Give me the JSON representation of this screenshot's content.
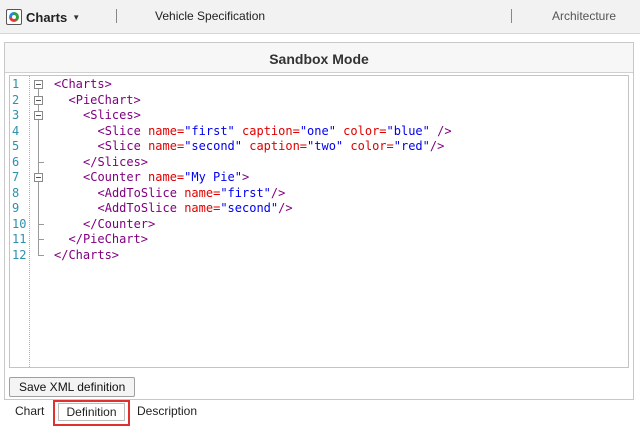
{
  "app": {
    "name": "Charts",
    "logo_icon": "pie-chart-logo-icon"
  },
  "top_tabs": [
    {
      "label": "Vehicle Specification"
    },
    {
      "label": "Architecture"
    }
  ],
  "panel": {
    "title": "Sandbox Mode"
  },
  "editor": {
    "lines": [
      {
        "n": "1",
        "parts": [
          [
            "tag",
            "<Charts>"
          ]
        ]
      },
      {
        "n": "2",
        "parts": [
          [
            "tag",
            "<PieChart>"
          ]
        ]
      },
      {
        "n": "3",
        "parts": [
          [
            "tag",
            "<Slices>"
          ]
        ]
      },
      {
        "n": "4",
        "parts": [
          [
            "tag",
            "<Slice "
          ],
          [
            "attr",
            "name="
          ],
          [
            "val",
            "\"first\""
          ],
          [
            "plain",
            " "
          ],
          [
            "attr",
            "caption="
          ],
          [
            "val",
            "\"one\""
          ],
          [
            "plain",
            " "
          ],
          [
            "attr",
            "color="
          ],
          [
            "val",
            "\"blue\""
          ],
          [
            "plain",
            " "
          ],
          [
            "tag",
            "/>"
          ]
        ]
      },
      {
        "n": "5",
        "parts": [
          [
            "tag",
            "<Slice "
          ],
          [
            "attr",
            "name="
          ],
          [
            "val",
            "\"second\""
          ],
          [
            "plain",
            " "
          ],
          [
            "attr",
            "caption="
          ],
          [
            "val",
            "\"two\""
          ],
          [
            "plain",
            " "
          ],
          [
            "attr",
            "color="
          ],
          [
            "val",
            "\"red\""
          ],
          [
            "tag",
            "/>"
          ]
        ]
      },
      {
        "n": "6",
        "parts": [
          [
            "tag",
            "</Slices>"
          ]
        ]
      },
      {
        "n": "7",
        "parts": [
          [
            "tag",
            "<Counter "
          ],
          [
            "attr",
            "name="
          ],
          [
            "val",
            "\"My Pie\""
          ],
          [
            "tag",
            ">"
          ]
        ]
      },
      {
        "n": "8",
        "parts": [
          [
            "tag",
            "<AddToSlice "
          ],
          [
            "attr",
            "name="
          ],
          [
            "val",
            "\"first\""
          ],
          [
            "tag",
            "/>"
          ]
        ]
      },
      {
        "n": "9",
        "parts": [
          [
            "tag",
            "<AddToSlice "
          ],
          [
            "attr",
            "name="
          ],
          [
            "val",
            "\"second\""
          ],
          [
            "tag",
            "/>"
          ]
        ]
      },
      {
        "n": "10",
        "parts": [
          [
            "tag",
            "</Counter>"
          ]
        ]
      },
      {
        "n": "11",
        "parts": [
          [
            "tag",
            "</PieChart>"
          ]
        ]
      },
      {
        "n": "12",
        "parts": [
          [
            "tag",
            "</Charts>"
          ]
        ]
      }
    ]
  },
  "buttons": {
    "save_xml": "Save XML definition"
  },
  "bottom_tabs": [
    {
      "label": "Chart"
    },
    {
      "label": "Definition",
      "active": true
    },
    {
      "label": "Description"
    }
  ],
  "colors": {
    "tag": "#800080",
    "attr": "#e00000",
    "value": "#0000ee",
    "line_number": "#2b91af",
    "highlight": "#e03030"
  }
}
